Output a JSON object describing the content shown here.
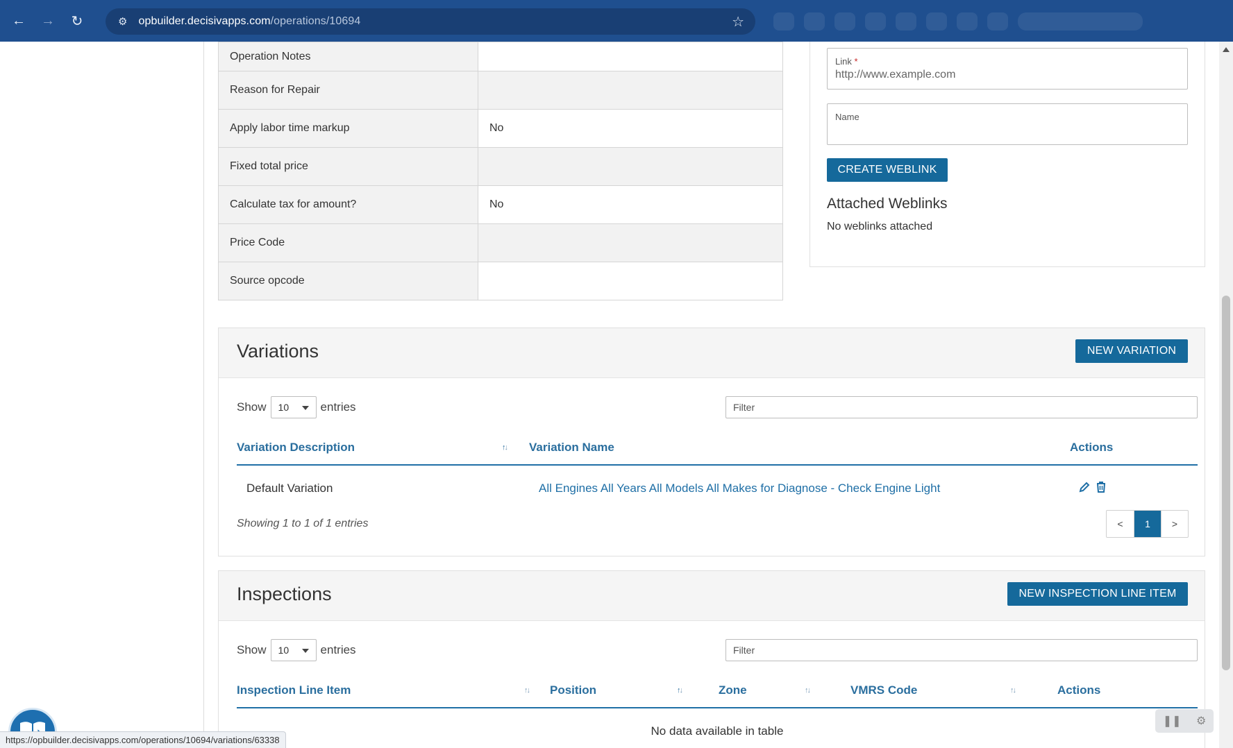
{
  "browser": {
    "url_host": "opbuilder.decisivapps.com",
    "url_path": "/operations/10694",
    "status_url": "https://opbuilder.decisivapps.com/operations/10694/variations/63338"
  },
  "details": [
    {
      "label": "Operation Notes",
      "value": ""
    },
    {
      "label": "Reason for Repair",
      "value": ""
    },
    {
      "label": "Apply labor time markup",
      "value": "No"
    },
    {
      "label": "Fixed total price",
      "value": ""
    },
    {
      "label": "Calculate tax for amount?",
      "value": "No"
    },
    {
      "label": "Price Code",
      "value": ""
    },
    {
      "label": "Source opcode",
      "value": ""
    }
  ],
  "weblinks": {
    "link_label": "Link",
    "link_required": "*",
    "link_placeholder": "http://www.example.com",
    "name_label": "Name",
    "create_button": "CREATE WEBLINK",
    "attached_title": "Attached Weblinks",
    "attached_empty": "No weblinks attached"
  },
  "variations": {
    "title": "Variations",
    "new_button": "NEW VARIATION",
    "show_label": "Show",
    "page_size": "10",
    "entries_label": "entries",
    "filter_placeholder": "Filter",
    "columns": [
      "Variation Description",
      "Variation Name",
      "Actions"
    ],
    "rows": [
      {
        "description": "Default Variation",
        "name": "All Engines All Years All Models All Makes for Diagnose - Check Engine Light"
      }
    ],
    "info": "Showing 1 to 1 of 1 entries",
    "pager": {
      "prev": "<",
      "current": "1",
      "next": ">"
    }
  },
  "inspections": {
    "title": "Inspections",
    "new_button": "NEW INSPECTION LINE ITEM",
    "show_label": "Show",
    "page_size": "10",
    "entries_label": "entries",
    "filter_placeholder": "Filter",
    "columns": [
      "Inspection Line Item",
      "Position",
      "Zone",
      "VMRS Code",
      "Actions"
    ],
    "empty": "No data available in table"
  },
  "icons": {
    "back": "arrow-left-icon",
    "forward": "arrow-right-icon",
    "reload": "reload-icon",
    "site_settings": "tune-icon",
    "bookmark": "star-icon",
    "edit": "pencil-icon",
    "delete": "trash-icon",
    "help": "book-cursor-icon",
    "recorder_pause": "pause-icon"
  },
  "colors": {
    "browser_bar": "#1f4f8f",
    "primary": "#15699b",
    "link": "#1f6fa6"
  }
}
